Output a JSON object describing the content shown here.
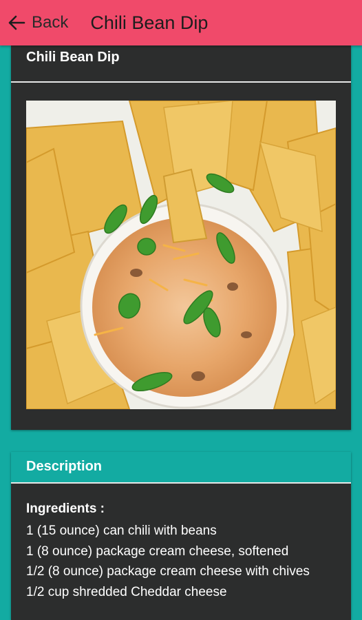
{
  "appbar": {
    "back_label": "Back",
    "title": "Chili Bean Dip",
    "color": "#f04a6a"
  },
  "recipe_card": {
    "title": "Chili Bean Dip",
    "image_icon": "dip-photo"
  },
  "description_card": {
    "header": "Description",
    "ingredients_title": "Ingredients :",
    "ingredients": [
      "1 (15 ounce) can chili with beans",
      "1 (8 ounce) package cream cheese, softened",
      "1/2 (8 ounce) package cream cheese with chives",
      "1/2 cup shredded Cheddar cheese"
    ]
  },
  "colors": {
    "background": "#13aba2",
    "card": "#2c2d2d",
    "accent": "#f04a6a"
  }
}
